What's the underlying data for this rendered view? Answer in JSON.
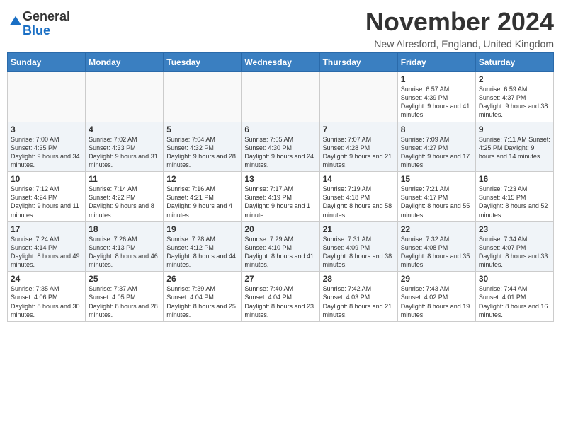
{
  "logo": {
    "general": "General",
    "blue": "Blue"
  },
  "header": {
    "month_year": "November 2024",
    "location": "New Alresford, England, United Kingdom"
  },
  "weekdays": [
    "Sunday",
    "Monday",
    "Tuesday",
    "Wednesday",
    "Thursday",
    "Friday",
    "Saturday"
  ],
  "weeks": [
    [
      {
        "day": "",
        "info": ""
      },
      {
        "day": "",
        "info": ""
      },
      {
        "day": "",
        "info": ""
      },
      {
        "day": "",
        "info": ""
      },
      {
        "day": "",
        "info": ""
      },
      {
        "day": "1",
        "info": "Sunrise: 6:57 AM\nSunset: 4:39 PM\nDaylight: 9 hours\nand 41 minutes."
      },
      {
        "day": "2",
        "info": "Sunrise: 6:59 AM\nSunset: 4:37 PM\nDaylight: 9 hours\nand 38 minutes."
      }
    ],
    [
      {
        "day": "3",
        "info": "Sunrise: 7:00 AM\nSunset: 4:35 PM\nDaylight: 9 hours\nand 34 minutes."
      },
      {
        "day": "4",
        "info": "Sunrise: 7:02 AM\nSunset: 4:33 PM\nDaylight: 9 hours\nand 31 minutes."
      },
      {
        "day": "5",
        "info": "Sunrise: 7:04 AM\nSunset: 4:32 PM\nDaylight: 9 hours\nand 28 minutes."
      },
      {
        "day": "6",
        "info": "Sunrise: 7:05 AM\nSunset: 4:30 PM\nDaylight: 9 hours\nand 24 minutes."
      },
      {
        "day": "7",
        "info": "Sunrise: 7:07 AM\nSunset: 4:28 PM\nDaylight: 9 hours\nand 21 minutes."
      },
      {
        "day": "8",
        "info": "Sunrise: 7:09 AM\nSunset: 4:27 PM\nDaylight: 9 hours\nand 17 minutes."
      },
      {
        "day": "9",
        "info": "Sunrise: 7:11 AM\nSunset: 4:25 PM\nDaylight: 9 hours\nand 14 minutes."
      }
    ],
    [
      {
        "day": "10",
        "info": "Sunrise: 7:12 AM\nSunset: 4:24 PM\nDaylight: 9 hours\nand 11 minutes."
      },
      {
        "day": "11",
        "info": "Sunrise: 7:14 AM\nSunset: 4:22 PM\nDaylight: 9 hours\nand 8 minutes."
      },
      {
        "day": "12",
        "info": "Sunrise: 7:16 AM\nSunset: 4:21 PM\nDaylight: 9 hours\nand 4 minutes."
      },
      {
        "day": "13",
        "info": "Sunrise: 7:17 AM\nSunset: 4:19 PM\nDaylight: 9 hours\nand 1 minute."
      },
      {
        "day": "14",
        "info": "Sunrise: 7:19 AM\nSunset: 4:18 PM\nDaylight: 8 hours\nand 58 minutes."
      },
      {
        "day": "15",
        "info": "Sunrise: 7:21 AM\nSunset: 4:17 PM\nDaylight: 8 hours\nand 55 minutes."
      },
      {
        "day": "16",
        "info": "Sunrise: 7:23 AM\nSunset: 4:15 PM\nDaylight: 8 hours\nand 52 minutes."
      }
    ],
    [
      {
        "day": "17",
        "info": "Sunrise: 7:24 AM\nSunset: 4:14 PM\nDaylight: 8 hours\nand 49 minutes."
      },
      {
        "day": "18",
        "info": "Sunrise: 7:26 AM\nSunset: 4:13 PM\nDaylight: 8 hours\nand 46 minutes."
      },
      {
        "day": "19",
        "info": "Sunrise: 7:28 AM\nSunset: 4:12 PM\nDaylight: 8 hours\nand 44 minutes."
      },
      {
        "day": "20",
        "info": "Sunrise: 7:29 AM\nSunset: 4:10 PM\nDaylight: 8 hours\nand 41 minutes."
      },
      {
        "day": "21",
        "info": "Sunrise: 7:31 AM\nSunset: 4:09 PM\nDaylight: 8 hours\nand 38 minutes."
      },
      {
        "day": "22",
        "info": "Sunrise: 7:32 AM\nSunset: 4:08 PM\nDaylight: 8 hours\nand 35 minutes."
      },
      {
        "day": "23",
        "info": "Sunrise: 7:34 AM\nSunset: 4:07 PM\nDaylight: 8 hours\nand 33 minutes."
      }
    ],
    [
      {
        "day": "24",
        "info": "Sunrise: 7:35 AM\nSunset: 4:06 PM\nDaylight: 8 hours\nand 30 minutes."
      },
      {
        "day": "25",
        "info": "Sunrise: 7:37 AM\nSunset: 4:05 PM\nDaylight: 8 hours\nand 28 minutes."
      },
      {
        "day": "26",
        "info": "Sunrise: 7:39 AM\nSunset: 4:04 PM\nDaylight: 8 hours\nand 25 minutes."
      },
      {
        "day": "27",
        "info": "Sunrise: 7:40 AM\nSunset: 4:04 PM\nDaylight: 8 hours\nand 23 minutes."
      },
      {
        "day": "28",
        "info": "Sunrise: 7:42 AM\nSunset: 4:03 PM\nDaylight: 8 hours\nand 21 minutes."
      },
      {
        "day": "29",
        "info": "Sunrise: 7:43 AM\nSunset: 4:02 PM\nDaylight: 8 hours\nand 19 minutes."
      },
      {
        "day": "30",
        "info": "Sunrise: 7:44 AM\nSunset: 4:01 PM\nDaylight: 8 hours\nand 16 minutes."
      }
    ]
  ]
}
